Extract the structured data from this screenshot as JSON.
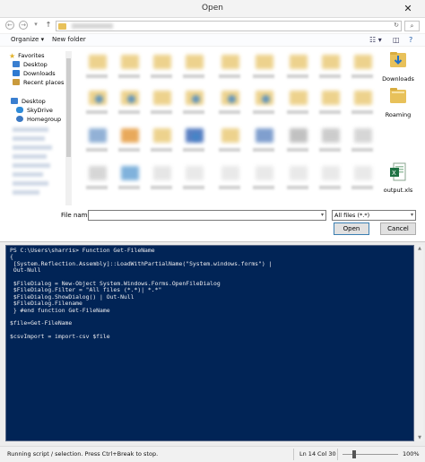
{
  "dialog": {
    "title": "Open",
    "close_glyph": "✕",
    "nav": {
      "back_glyph": "←",
      "forward_glyph": "→",
      "recent_glyph": "▾",
      "up_glyph": "↑",
      "refresh_glyph": "↻",
      "search_glyph": "⌕"
    },
    "toolbar": {
      "organize": "Organize ▾",
      "new_folder": "New folder",
      "view_glyph": "☷ ▾",
      "preview_glyph": "◫",
      "help_glyph": "?"
    },
    "nav_pane": {
      "favorites": "Favorites",
      "desktop": "Desktop",
      "downloads": "Downloads",
      "recent_places": "Recent places",
      "desktop2": "Desktop",
      "skydrive": "SkyDrive",
      "homegroup": "Homegroup"
    },
    "files": {
      "downloads": "Downloads",
      "roaming": "Roaming",
      "output": "output.xls"
    },
    "file_name_label": "File name:",
    "file_name_value": "",
    "filter_value": "All files (*.*)",
    "open_button": "Open",
    "cancel_button": "Cancel"
  },
  "powershell": {
    "script": "PS C:\\Users\\sharris> Function Get-FileName\n{\n [System.Reflection.Assembly]::LoadWithPartialName(\"System.windows.forms\") |\n Out-Null\n\n $FileDialog = New-Object System.Windows.Forms.OpenFileDialog\n $FileDialog.Filter = \"All files (*.*)| *.*\"\n $FileDialog.ShowDialog() | Out-Null\n $FileDialog.Filename\n } #end function Get-FileName\n\n$file=Get-FileName\n\n$csvImport = import-csv $file"
  },
  "status": {
    "message": "Running script / selection.  Press Ctrl+Break to stop.",
    "line": "Ln 14",
    "col": "Col 30",
    "zoom": "100%"
  },
  "colors": {
    "console_bg": "#012456",
    "console_fg": "#eeedf0",
    "folder": "#e8c15a",
    "excel_green": "#1f7244"
  }
}
